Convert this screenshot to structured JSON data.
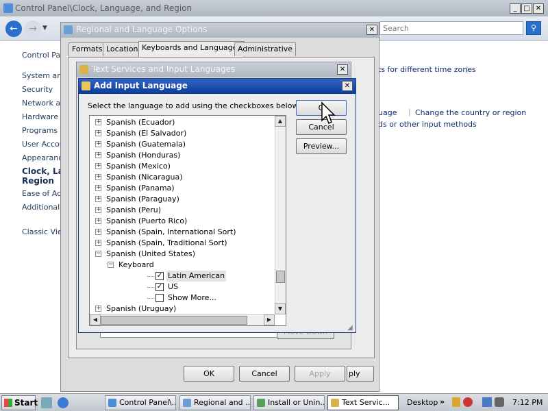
{
  "control_panel": {
    "title": "Control Panel\\Clock, Language, and Region",
    "search_placeholder": "Search",
    "home_label": "Control Panel Home",
    "nav": [
      "System and Maintenance",
      "Security",
      "Network and Internet",
      "Hardware and Sound",
      "Programs",
      "User Accounts",
      "Appearance and Personalization",
      "Clock, Language, and Region",
      "Ease of Access",
      "Additional Options"
    ],
    "nav_visible": [
      "Control Panel",
      "System and",
      "Security",
      "Network and",
      "Hardware and",
      "Programs",
      "User Accou",
      "Appearance",
      "Clock, Lan",
      "Region",
      "Ease of Acc",
      "Additional O"
    ],
    "classic_view": "Classic View",
    "content_links": {
      "time_zones": "ts for different time zones",
      "language": "uage",
      "change_country": "Change the country or region",
      "input_methods": "ds or other input methods"
    }
  },
  "regional_dialog": {
    "title": "Regional and Language Options",
    "tabs": [
      "Formats",
      "Location",
      "Keyboards and Languages",
      "Administrative"
    ],
    "selected_tab": "Keyboards and Languages",
    "buttons": {
      "ok": "OK",
      "cancel": "Cancel",
      "apply": "Apply",
      "ply": "ply"
    }
  },
  "text_services_dialog": {
    "title": "Text Services and Input Languages",
    "move_down": "Move Down"
  },
  "add_input_dialog": {
    "title": "Add Input Language",
    "instruction": "Select the language to add using the checkboxes below.",
    "buttons": {
      "ok": "OK",
      "cancel": "Cancel",
      "preview": "Preview..."
    },
    "ok_visible": "O",
    "tree": [
      {
        "label": "Spanish (Ecuador)",
        "level": 0,
        "expander": "+"
      },
      {
        "label": "Spanish (El Salvador)",
        "level": 0,
        "expander": "+"
      },
      {
        "label": "Spanish (Guatemala)",
        "level": 0,
        "expander": "+"
      },
      {
        "label": "Spanish (Honduras)",
        "level": 0,
        "expander": "+"
      },
      {
        "label": "Spanish (Mexico)",
        "level": 0,
        "expander": "+"
      },
      {
        "label": "Spanish (Nicaragua)",
        "level": 0,
        "expander": "+"
      },
      {
        "label": "Spanish (Panama)",
        "level": 0,
        "expander": "+"
      },
      {
        "label": "Spanish (Paraguay)",
        "level": 0,
        "expander": "+"
      },
      {
        "label": "Spanish (Peru)",
        "level": 0,
        "expander": "+"
      },
      {
        "label": "Spanish (Puerto Rico)",
        "level": 0,
        "expander": "+"
      },
      {
        "label": "Spanish (Spain, International Sort)",
        "level": 0,
        "expander": "+"
      },
      {
        "label": "Spanish (Spain, Traditional Sort)",
        "level": 0,
        "expander": "+"
      },
      {
        "label": "Spanish (United States)",
        "level": 0,
        "expander": "-"
      },
      {
        "label": "Keyboard",
        "level": 1,
        "expander": "-"
      },
      {
        "label": "Latin American",
        "level": 2,
        "checked": true,
        "selected": true
      },
      {
        "label": "US",
        "level": 2,
        "checked": true
      },
      {
        "label": "Show More...",
        "level": 2,
        "checked": false
      },
      {
        "label": "Spanish (Uruguay)",
        "level": 0,
        "expander": "+"
      }
    ]
  },
  "taskbar": {
    "start": "Start",
    "tasks": [
      "Control Panel\\...",
      "Regional and ...",
      "Install or Unin...",
      "Text Servic..."
    ],
    "active_task": "Text Servic...",
    "desktop": "Desktop",
    "clock": "7:12 PM"
  }
}
